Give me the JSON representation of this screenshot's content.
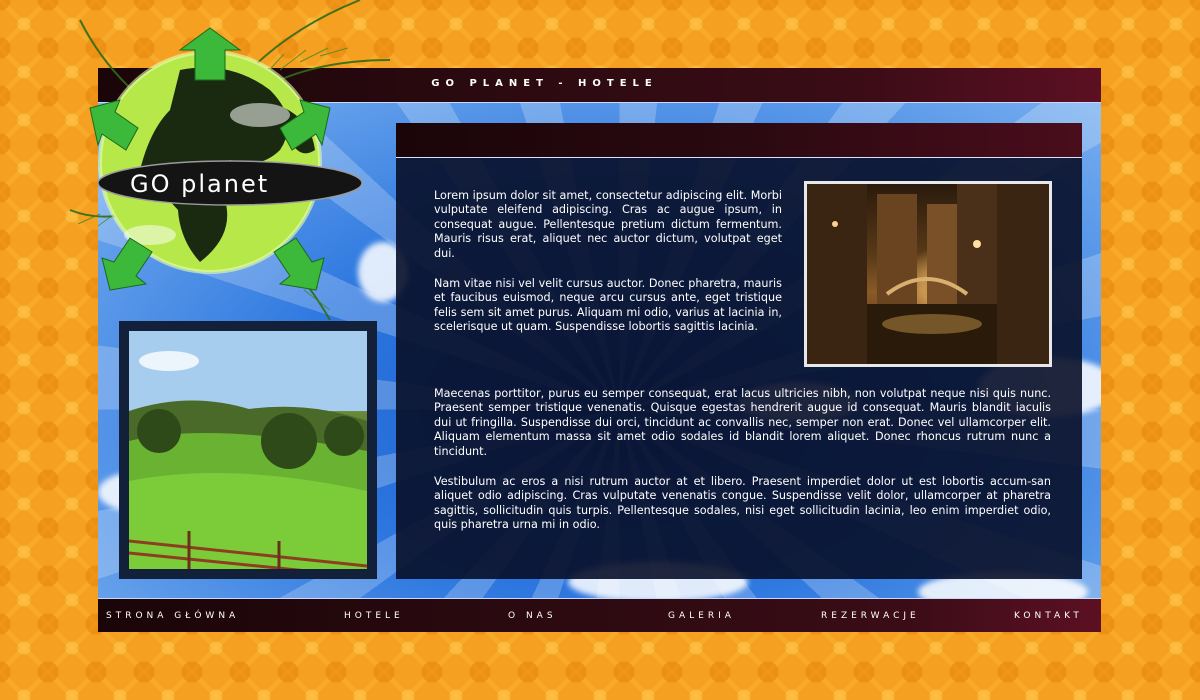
{
  "site": {
    "title": "GO PLANET - HOTELE"
  },
  "logo": {
    "text": "GO planet"
  },
  "content": {
    "paragraph1": "Lorem ipsum dolor sit amet, consectetur adipiscing elit. Morbi vulputate eleifend adipiscing. Cras ac augue ipsum, in consequat augue. Pellentesque pretium dictum fermentum. Mauris risus erat, aliquet nec auctor dictum, volutpat eget dui.",
    "paragraph2": "Nam vitae nisi vel velit cursus auctor. Donec pharetra, mauris et faucibus euismod, neque arcu cursus ante, eget tristique felis sem sit amet purus. Aliquam mi odio, varius at lacinia in, scelerisque ut quam. Suspendisse lobortis sagittis lacinia.",
    "paragraph3": "Maecenas porttitor, purus eu semper consequat, erat lacus ultricies nibh, non volutpat neque nisi quis nunc. Praesent semper tristique venenatis. Quisque egestas hendrerit augue id consequat. Mauris blandit iaculis dui ut fringilla. Suspendisse dui orci, tincidunt ac convallis nec, semper non erat. Donec vel ullamcorper elit. Aliquam elementum massa sit amet odio sodales id blandit lorem aliquet. Donec rhoncus rutrum nunc a tincidunt.",
    "paragraph4": "Vestibulum ac eros a nisi rutrum auctor at et libero. Praesent imperdiet dolor ut est lobortis accum-san aliquet odio adipiscing. Cras vulputate venenatis congue. Suspendisse velit dolor, ullamcorper at pharetra sagittis, sollicitudin quis turpis. Pellentesque sodales, nisi eget sollicitudin lacinia, leo enim imperdiet odio, quis pharetra urna mi in odio."
  },
  "nav": {
    "items": [
      {
        "label": "STRONA GŁÓWNA"
      },
      {
        "label": "HOTELE"
      },
      {
        "label": "O NAS"
      },
      {
        "label": "GALERIA"
      },
      {
        "label": "REZERWACJE"
      },
      {
        "label": "KONTAKT"
      }
    ]
  },
  "colors": {
    "background": "#f5a020",
    "bar_dark": "#1a0508",
    "bar_accent": "#5c1022",
    "sky": "#2a6fd8",
    "panel": "#080e28",
    "globe_green": "#a8e03a"
  },
  "icons": {
    "globe": "globe-logo-icon",
    "arrows": "green-arrow-icon",
    "palm": "palm-leaf-icon"
  }
}
